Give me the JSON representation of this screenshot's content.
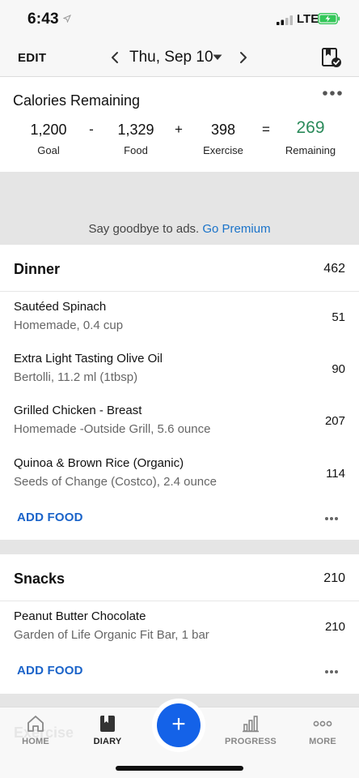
{
  "status_bar": {
    "time": "6:43",
    "network": "LTE"
  },
  "nav": {
    "edit_label": "EDIT",
    "date": "Thu, Sep 10"
  },
  "calories": {
    "title": "Calories Remaining",
    "goal": "1,200",
    "goal_label": "Goal",
    "minus": "-",
    "food": "1,329",
    "food_label": "Food",
    "plus": "+",
    "exercise": "398",
    "exercise_label": "Exercise",
    "equals": "=",
    "remaining": "269",
    "remaining_label": "Remaining"
  },
  "ad": {
    "text": "Say goodbye to ads.",
    "link": "Go Premium"
  },
  "dinner": {
    "title": "Dinner",
    "total": "462",
    "items": [
      {
        "name": "Sautéed Spinach",
        "desc": "Homemade, 0.4 cup",
        "calories": "51"
      },
      {
        "name": "Extra Light Tasting Olive Oil",
        "desc": "Bertolli, 11.2 ml (1tbsp)",
        "calories": "90"
      },
      {
        "name": "Grilled Chicken - Breast",
        "desc": "Homemade -Outside Grill, 5.6 ounce",
        "calories": "207"
      },
      {
        "name": "Quinoa & Brown Rice (Organic)",
        "desc": "Seeds of Change (Costco), 2.4 ounce",
        "calories": "114"
      }
    ],
    "add_label": "ADD FOOD"
  },
  "snacks": {
    "title": "Snacks",
    "total": "210",
    "items": [
      {
        "name": "Peanut Butter Chocolate",
        "desc": "Garden of Life Organic Fit Bar, 1 bar",
        "calories": "210"
      }
    ],
    "add_label": "ADD FOOD"
  },
  "behind": {
    "exercise_title": "Exercise"
  },
  "tabs": [
    {
      "label": "HOME",
      "icon": "home-icon"
    },
    {
      "label": "DIARY",
      "icon": "diary-icon",
      "active": true
    },
    {
      "label": "PROGRESS",
      "icon": "progress-icon"
    },
    {
      "label": "MORE",
      "icon": "more-icon"
    }
  ],
  "colors": {
    "accent": "#1462e8",
    "link": "#1a63c9",
    "remaining": "#2a8a5a",
    "battery": "#34c759"
  }
}
